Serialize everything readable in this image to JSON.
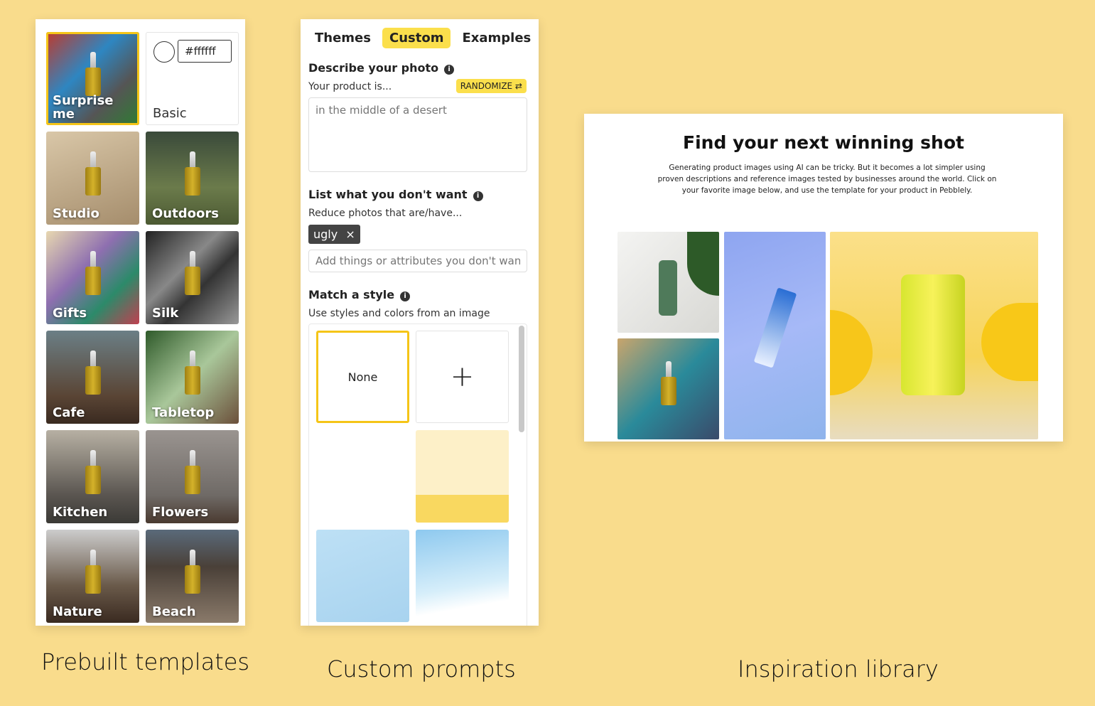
{
  "templates": {
    "basic": {
      "label": "Basic",
      "color_value": "#ffffff"
    },
    "items": [
      {
        "label": "Surprise me",
        "selected": true
      },
      {
        "label": "Studio"
      },
      {
        "label": "Outdoors"
      },
      {
        "label": "Gifts"
      },
      {
        "label": "Silk"
      },
      {
        "label": "Cafe"
      },
      {
        "label": "Tabletop"
      },
      {
        "label": "Kitchen"
      },
      {
        "label": "Flowers"
      },
      {
        "label": "Nature"
      },
      {
        "label": "Beach"
      }
    ]
  },
  "custom": {
    "tabs": [
      {
        "label": "Themes"
      },
      {
        "label": "Custom",
        "active": true
      },
      {
        "label": "Examples"
      }
    ],
    "describe": {
      "heading": "Describe your photo",
      "sub": "Your product is...",
      "randomize": "RANDOMIZE ⇄",
      "placeholder": "in the middle of a desert"
    },
    "negative": {
      "heading": "List what you don't want",
      "sub": "Reduce photos that are/have...",
      "chip": "ugly",
      "chip_remove": "×",
      "placeholder": "Add things or attributes you don't want"
    },
    "style": {
      "heading": "Match a style",
      "sub": "Use styles and colors from an image",
      "none": "None",
      "add": "+"
    }
  },
  "library": {
    "title": "Find your next winning shot",
    "description": "Generating product images using AI can be tricky. But it becomes a lot simpler using proven descriptions and reference images tested by businesses around the world. Click on your favorite image below, and use the template for your product in Pebblely."
  },
  "captions": {
    "left": "Prebuilt templates",
    "middle": "Custom prompts",
    "right": "Inspiration library"
  },
  "colors": {
    "accent": "#fbdf4c",
    "selected_border": "#f5c518",
    "background": "#f9dc8c"
  }
}
